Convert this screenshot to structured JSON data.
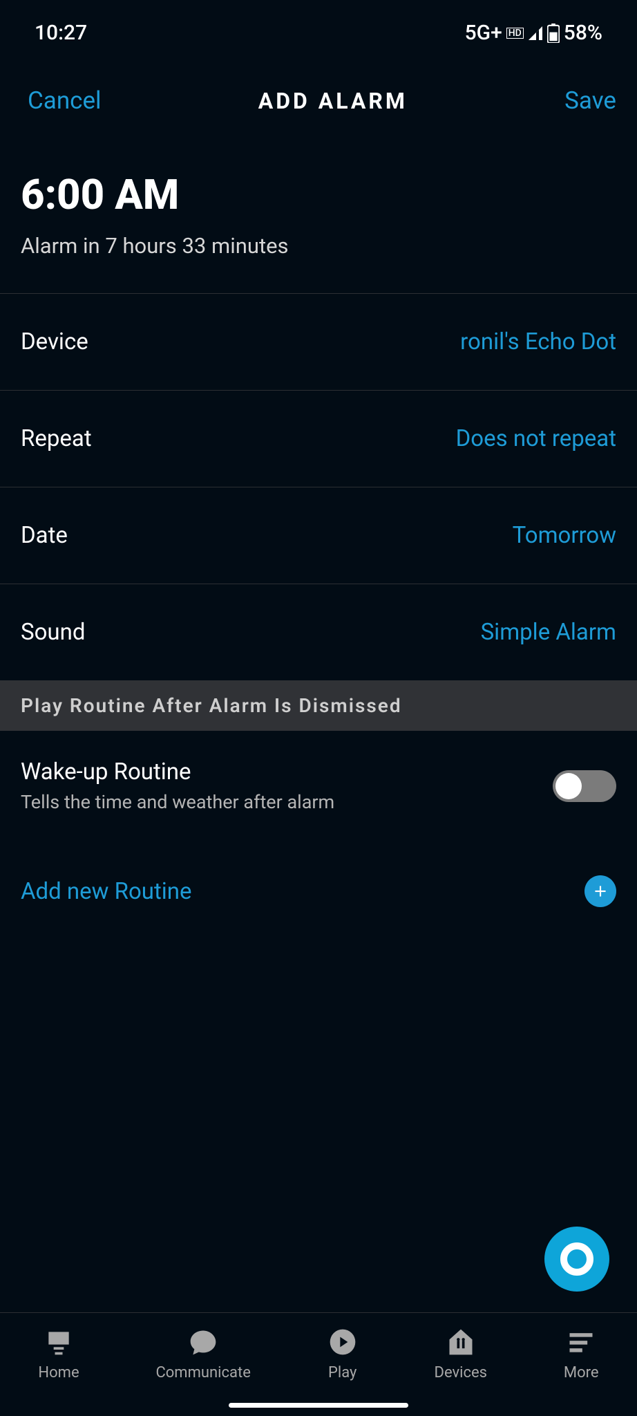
{
  "status": {
    "time": "10:27",
    "network": "5G+",
    "hd": "HD",
    "battery": "58%"
  },
  "header": {
    "cancel": "Cancel",
    "title": "ADD ALARM",
    "save": "Save"
  },
  "alarm": {
    "time": "6:00 AM",
    "subtitle": "Alarm in 7 hours 33 minutes"
  },
  "rows": {
    "device": {
      "label": "Device",
      "value": "ronil's Echo Dot"
    },
    "repeat": {
      "label": "Repeat",
      "value": "Does not repeat"
    },
    "date": {
      "label": "Date",
      "value": "Tomorrow"
    },
    "sound": {
      "label": "Sound",
      "value": "Simple Alarm"
    }
  },
  "section_header": "Play Routine After Alarm Is Dismissed",
  "wakeup": {
    "title": "Wake-up Routine",
    "desc": "Tells the time and weather after alarm",
    "enabled": false
  },
  "add_routine": "Add new Routine",
  "nav": {
    "home": "Home",
    "communicate": "Communicate",
    "play": "Play",
    "devices": "Devices",
    "more": "More"
  }
}
